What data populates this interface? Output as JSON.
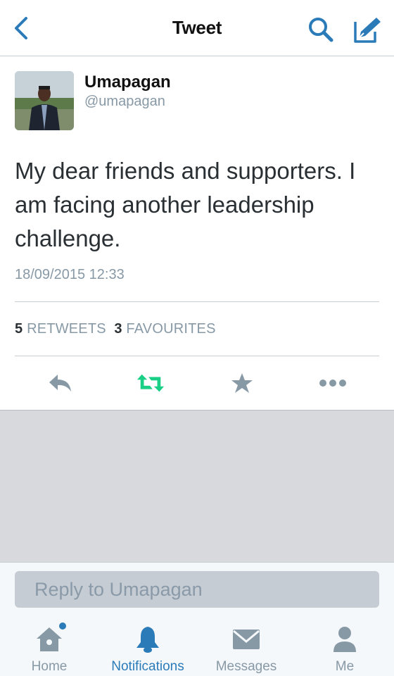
{
  "navbar": {
    "title": "Tweet",
    "back_icon": "chevron-left-icon",
    "search_icon": "search-icon",
    "compose_icon": "compose-icon",
    "accent_color": "#2b7bb9"
  },
  "tweet": {
    "display_name": "Umapagan",
    "handle": "@umapagan",
    "text": "My dear friends and supporters. I am facing another leadership challenge.",
    "timestamp": "18/09/2015 12:33",
    "stats": {
      "retweets_count": "5",
      "retweets_label": "RETWEETS",
      "favourites_count": "3",
      "favourites_label": "FAVOURITES"
    },
    "actions": [
      {
        "name": "reply",
        "icon": "reply-icon"
      },
      {
        "name": "retweet",
        "icon": "retweet-icon",
        "color": "#19cf86"
      },
      {
        "name": "favourite",
        "icon": "star-icon"
      },
      {
        "name": "more",
        "icon": "more-icon"
      }
    ]
  },
  "reply": {
    "placeholder": "Reply to Umapagan"
  },
  "tabbar": {
    "items": [
      {
        "label": "Home",
        "icon": "home-icon",
        "active": false,
        "badge": true
      },
      {
        "label": "Notifications",
        "icon": "bell-icon",
        "active": true
      },
      {
        "label": "Messages",
        "icon": "envelope-icon",
        "active": false
      },
      {
        "label": "Me",
        "icon": "person-icon",
        "active": false
      }
    ]
  }
}
